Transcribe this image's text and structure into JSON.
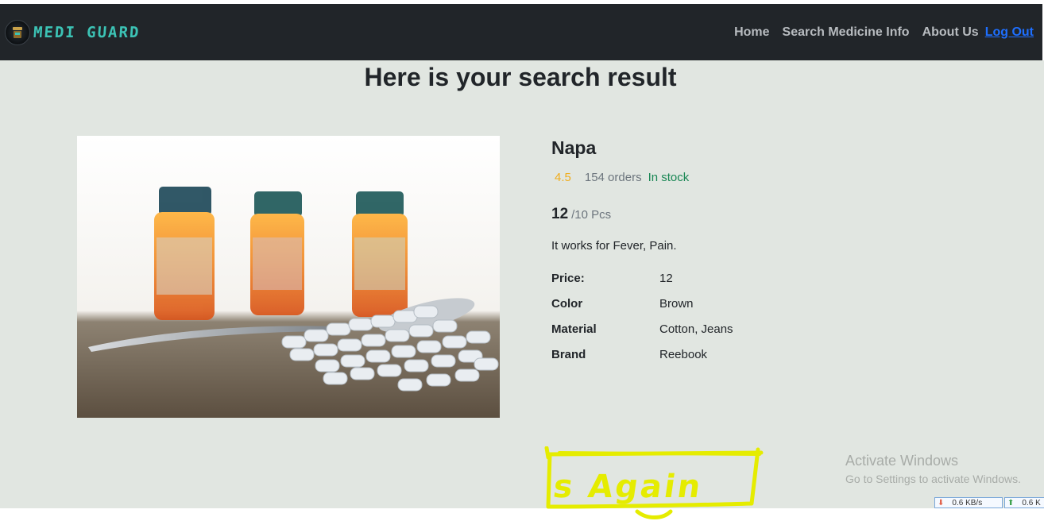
{
  "navbar": {
    "brand": "MEDI GUARD",
    "links": [
      "Home",
      "Search Medicine Info",
      "About Us"
    ],
    "logout": "Log Out"
  },
  "main": {
    "title": "Here is your search result",
    "product": {
      "name": "Napa",
      "rating": "4.5",
      "orders": "154 orders",
      "stock": "In stock",
      "price": "12",
      "price_unit": "/10 Pcs",
      "description": "It works for Fever, Pain.",
      "specs": [
        {
          "key": "Price:",
          "value": "12"
        },
        {
          "key": "Color",
          "value": "Brown"
        },
        {
          "key": "Material",
          "value": "Cotton, Jeans"
        },
        {
          "key": "Brand",
          "value": "Reebook"
        }
      ]
    },
    "scribble_text": "s Again"
  },
  "os_overlay": {
    "activate_title": "Activate Windows",
    "activate_sub": "Go to Settings to activate Windows.",
    "download": "0.6 KB/s",
    "upload": "0.6 K"
  },
  "colors": {
    "navbar_bg": "#212529",
    "page_bg": "#e1e6e1",
    "brand": "#3cc3b5",
    "rating": "#f0ad1c",
    "stock": "#198754",
    "logout_link": "#1e6fff",
    "scribble": "#e5ec00"
  }
}
